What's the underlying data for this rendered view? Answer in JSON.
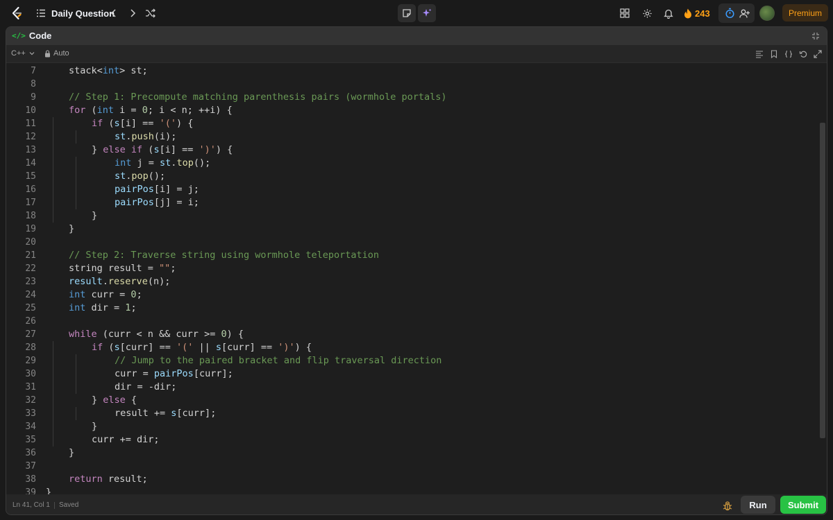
{
  "header": {
    "problem_list_label": "Daily Question",
    "streak_count": "243",
    "premium_label": "Premium",
    "accent_color": "#ffa116"
  },
  "panel": {
    "title": "Code",
    "language": "C++",
    "autosave_label": "Auto"
  },
  "editor": {
    "lines": [
      {
        "n": "7",
        "i": 1
      },
      {
        "n": "8",
        "i": 0
      },
      {
        "n": "9",
        "i": 1
      },
      {
        "n": "10",
        "i": 1
      },
      {
        "n": "11",
        "i": 2
      },
      {
        "n": "12",
        "i": 3
      },
      {
        "n": "13",
        "i": 2
      },
      {
        "n": "14",
        "i": 3
      },
      {
        "n": "15",
        "i": 3
      },
      {
        "n": "16",
        "i": 3
      },
      {
        "n": "17",
        "i": 3
      },
      {
        "n": "18",
        "i": 2
      },
      {
        "n": "19",
        "i": 1
      },
      {
        "n": "20",
        "i": 0
      },
      {
        "n": "21",
        "i": 1
      },
      {
        "n": "22",
        "i": 1
      },
      {
        "n": "23",
        "i": 1
      },
      {
        "n": "24",
        "i": 1
      },
      {
        "n": "25",
        "i": 1
      },
      {
        "n": "26",
        "i": 0
      },
      {
        "n": "27",
        "i": 1
      },
      {
        "n": "28",
        "i": 2
      },
      {
        "n": "29",
        "i": 3
      },
      {
        "n": "30",
        "i": 3
      },
      {
        "n": "31",
        "i": 3
      },
      {
        "n": "32",
        "i": 2
      },
      {
        "n": "33",
        "i": 3
      },
      {
        "n": "34",
        "i": 2
      },
      {
        "n": "35",
        "i": 2
      },
      {
        "n": "36",
        "i": 1
      },
      {
        "n": "37",
        "i": 0
      },
      {
        "n": "38",
        "i": 1
      },
      {
        "n": "39",
        "i": 0
      }
    ],
    "tokens": [
      [
        [
          "",
          "stack<"
        ],
        [
          "ty",
          "int"
        ],
        [
          "",
          "> st;"
        ]
      ],
      [],
      [
        [
          "cm",
          "// Step 1: Precompute matching parenthesis pairs (wormhole portals)"
        ]
      ],
      [
        [
          "kw",
          "for"
        ],
        [
          "",
          " ("
        ],
        [
          "ty",
          "int"
        ],
        [
          "",
          " i = "
        ],
        [
          "nm",
          "0"
        ],
        [
          "",
          "; i < n; ++i) {"
        ]
      ],
      [
        [
          "kw",
          "if"
        ],
        [
          "",
          " ("
        ],
        [
          "vr",
          "s"
        ],
        [
          "",
          "[i] == "
        ],
        [
          "st",
          "'('"
        ],
        [
          "",
          ") {"
        ]
      ],
      [
        [
          "vr",
          "st"
        ],
        [
          "",
          "."
        ],
        [
          "fn",
          "push"
        ],
        [
          "",
          "(i);"
        ]
      ],
      [
        [
          "",
          "} "
        ],
        [
          "kw",
          "else if"
        ],
        [
          "",
          " ("
        ],
        [
          "vr",
          "s"
        ],
        [
          "",
          "[i] == "
        ],
        [
          "st",
          "')'"
        ],
        [
          "",
          ") {"
        ]
      ],
      [
        [
          "ty",
          "int"
        ],
        [
          "",
          " j = "
        ],
        [
          "vr",
          "st"
        ],
        [
          "",
          "."
        ],
        [
          "fn",
          "top"
        ],
        [
          "",
          "();"
        ]
      ],
      [
        [
          "vr",
          "st"
        ],
        [
          "",
          "."
        ],
        [
          "fn",
          "pop"
        ],
        [
          "",
          "();"
        ]
      ],
      [
        [
          "vr",
          "pairPos"
        ],
        [
          "",
          "[i] = j;"
        ]
      ],
      [
        [
          "vr",
          "pairPos"
        ],
        [
          "",
          "[j] = i;"
        ]
      ],
      [
        [
          "",
          "}"
        ]
      ],
      [
        [
          "",
          "}"
        ]
      ],
      [],
      [
        [
          "cm",
          "// Step 2: Traverse string using wormhole teleportation"
        ]
      ],
      [
        [
          "",
          "string result = "
        ],
        [
          "st",
          "\"\""
        ],
        [
          "",
          ";"
        ]
      ],
      [
        [
          "vr",
          "result"
        ],
        [
          "",
          "."
        ],
        [
          "fn",
          "reserve"
        ],
        [
          "",
          "(n);"
        ]
      ],
      [
        [
          "ty",
          "int"
        ],
        [
          "",
          " curr = "
        ],
        [
          "nm",
          "0"
        ],
        [
          "",
          ";"
        ]
      ],
      [
        [
          "ty",
          "int"
        ],
        [
          "",
          " dir = "
        ],
        [
          "nm",
          "1"
        ],
        [
          "",
          ";"
        ]
      ],
      [],
      [
        [
          "kw",
          "while"
        ],
        [
          "",
          " (curr < n && curr >= "
        ],
        [
          "nm",
          "0"
        ],
        [
          "",
          ") {"
        ]
      ],
      [
        [
          "kw",
          "if"
        ],
        [
          "",
          " ("
        ],
        [
          "vr",
          "s"
        ],
        [
          "",
          "[curr] == "
        ],
        [
          "st",
          "'('"
        ],
        [
          "",
          " || "
        ],
        [
          "vr",
          "s"
        ],
        [
          "",
          "[curr] == "
        ],
        [
          "st",
          "')'"
        ],
        [
          "",
          ") {"
        ]
      ],
      [
        [
          "cm",
          "// Jump to the paired bracket and flip traversal direction"
        ]
      ],
      [
        [
          "",
          "curr = "
        ],
        [
          "vr",
          "pairPos"
        ],
        [
          "",
          "[curr];"
        ]
      ],
      [
        [
          "",
          "dir = -dir;"
        ]
      ],
      [
        [
          "",
          "} "
        ],
        [
          "kw",
          "else"
        ],
        [
          "",
          " {"
        ]
      ],
      [
        [
          "",
          "result += "
        ],
        [
          "vr",
          "s"
        ],
        [
          "",
          "[curr];"
        ]
      ],
      [
        [
          "",
          "}"
        ]
      ],
      [
        [
          "",
          "curr += dir;"
        ]
      ],
      [
        [
          "",
          "}"
        ]
      ],
      [],
      [
        [
          "kw",
          "return"
        ],
        [
          "",
          " result;"
        ]
      ],
      [
        [
          "",
          "}"
        ]
      ]
    ]
  },
  "footer": {
    "cursor_position": "Ln 41, Col 1",
    "save_status": "Saved",
    "run_label": "Run",
    "submit_label": "Submit",
    "submit_color": "#28c244"
  }
}
